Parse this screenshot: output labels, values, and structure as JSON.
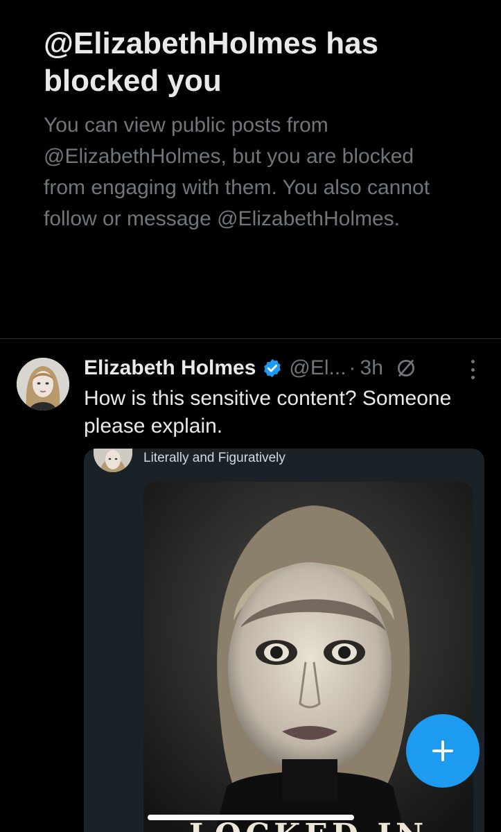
{
  "blocked_banner": {
    "title": "@ElizabethHolmes has blocked you",
    "description": "You can view public posts from @ElizabethHolmes, but you are blocked from engaging with them. You also cannot follow or message @ElizabethHolmes."
  },
  "post": {
    "display_name": "Elizabeth Holmes",
    "handle": "@El...",
    "separator": "·",
    "time": "3h",
    "text": "How is this sensitive content? Someone please explain.",
    "media": {
      "caption": "Literally and Figuratively",
      "poster_title": "LOCKED IN"
    }
  },
  "colors": {
    "background": "#000000",
    "accent": "#1d9bf0",
    "primary_text": "#e7e9ea",
    "secondary_text": "#71767b"
  },
  "icons": {
    "verified": "verified-badge-icon",
    "sensitive": "sensitive-content-icon",
    "more": "more-vertical-icon",
    "compose": "plus-icon"
  }
}
